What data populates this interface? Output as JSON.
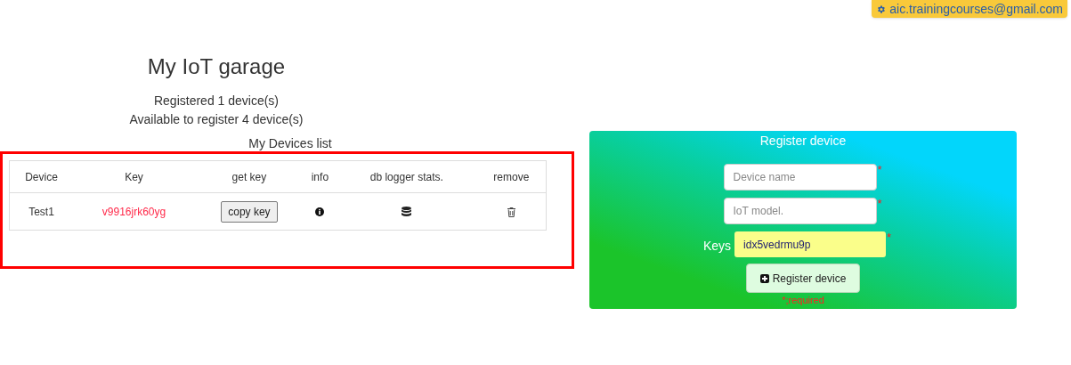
{
  "user_badge": {
    "email": "aic.trainingcourses@gmail.com"
  },
  "header": {
    "title": "My IoT garage",
    "registered": "Registered 1 device(s)",
    "available": "Available to register 4 device(s)"
  },
  "devices": {
    "title": "My Devices list",
    "highlighted": true,
    "columns": [
      "Device",
      "Key",
      "get key",
      "info",
      "db logger stats.",
      "remove"
    ],
    "rows": [
      {
        "device": "Test1",
        "key": "v9916jrk60yg",
        "copy_button": "copy key"
      }
    ]
  },
  "register_form": {
    "title": "Register device",
    "fields": [
      {
        "kind": "text",
        "placeholder": "Device name",
        "required_mark": "*"
      },
      {
        "kind": "text",
        "placeholder": "IoT model.",
        "required_mark": "*"
      },
      {
        "kind": "key",
        "label": "Keys",
        "value": "idx5vedrmu9p",
        "required_mark": "*"
      }
    ],
    "button": "Register device",
    "note": "*;required"
  }
}
